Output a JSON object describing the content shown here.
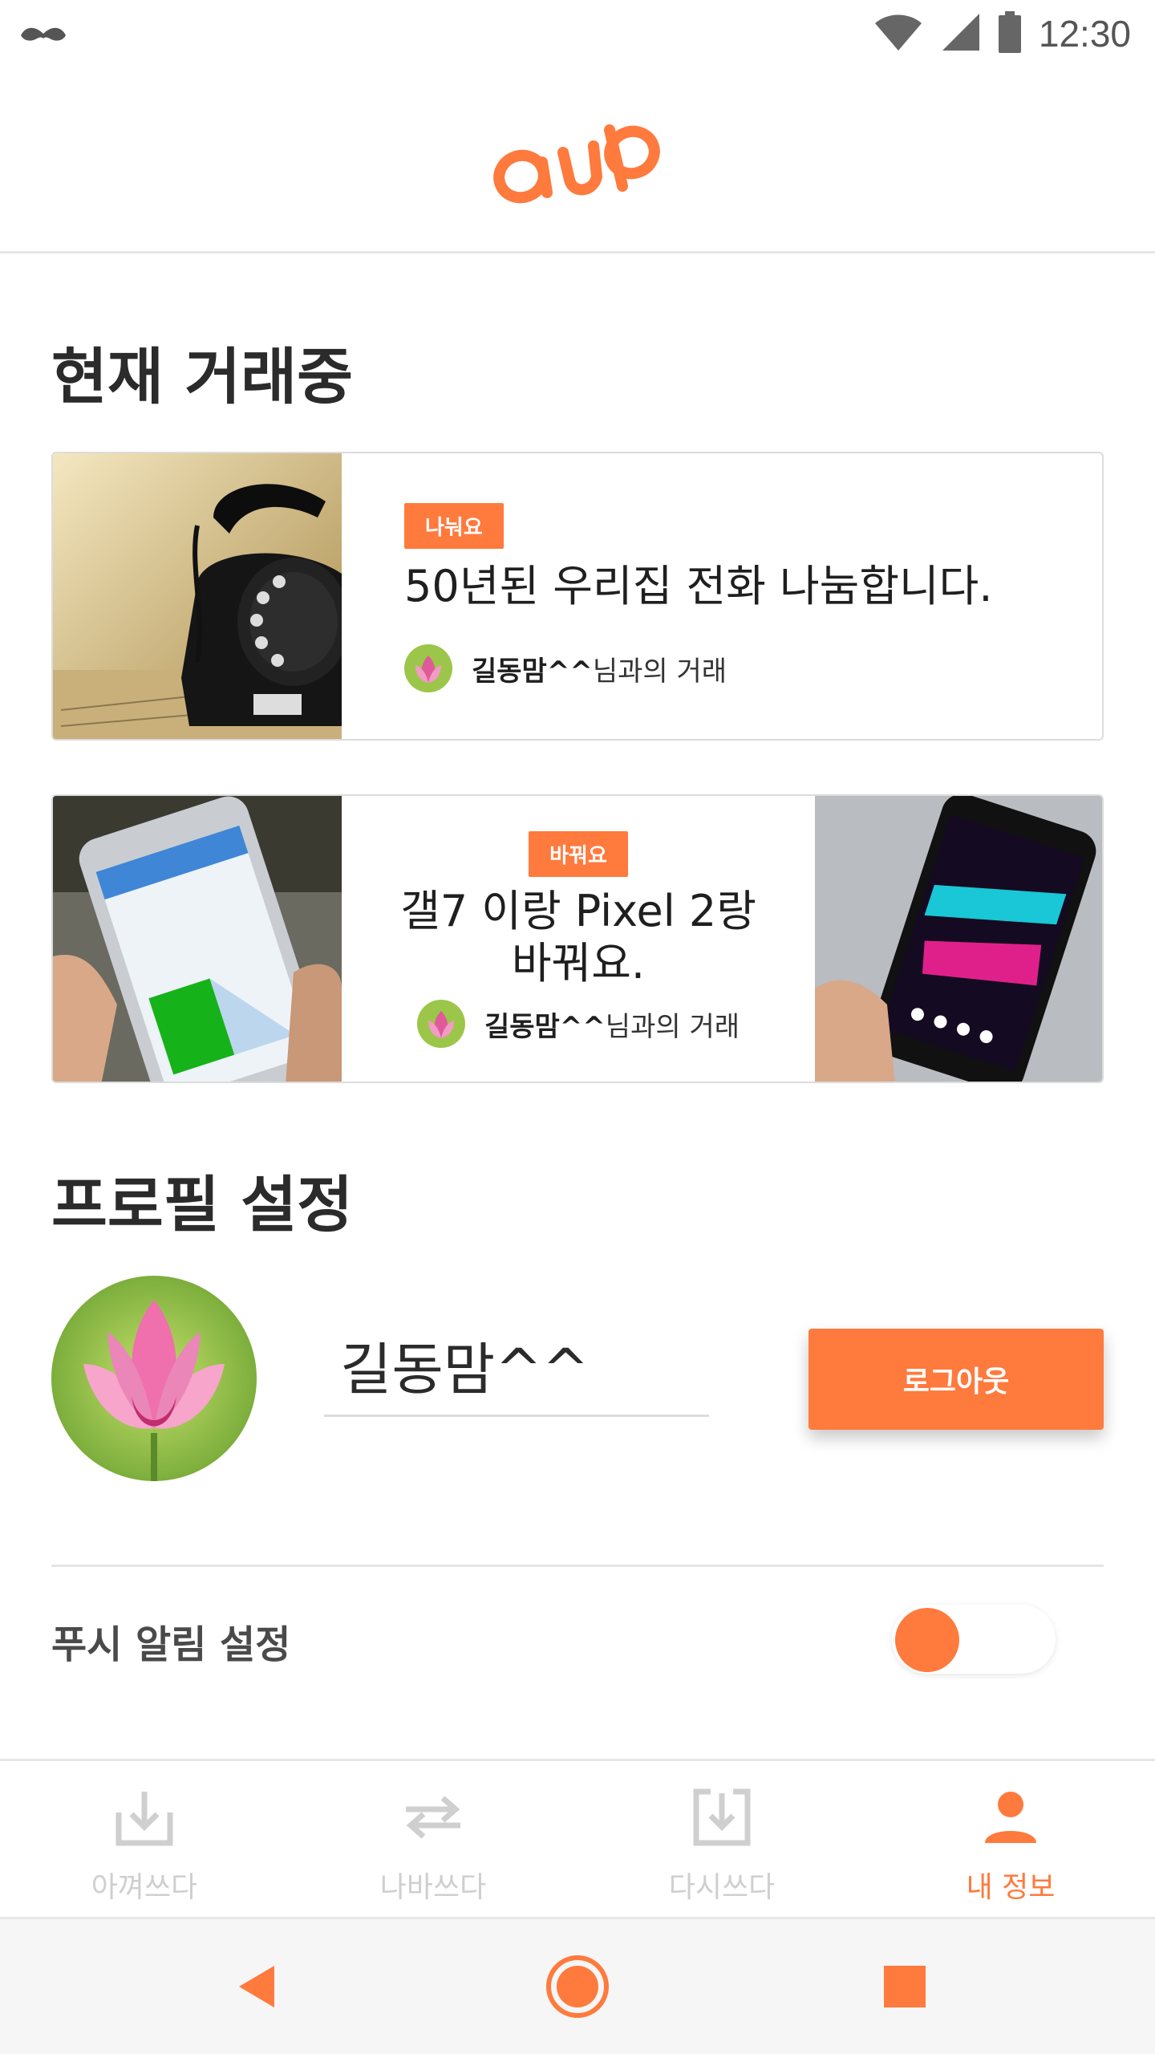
{
  "status_bar": {
    "time": "12:30"
  },
  "colors": {
    "accent": "#ff7a3d",
    "text_dark": "#2b2b2b",
    "tab_inactive": "#cfcfcf"
  },
  "sections": {
    "trading_title": "현재 거래중",
    "profile_title": "프로필 설정"
  },
  "trades": [
    {
      "badge": "나눠요",
      "title": "50년된 우리집 전화 나눔합니다.",
      "partner_name": "길동맘^^",
      "partner_suffix": "님과의 거래"
    },
    {
      "badge": "바꿔요",
      "title_line1": "갤7 이랑 Pixel 2랑",
      "title_line2": "바꿔요.",
      "partner_name": "길동맘^^",
      "partner_suffix": "님과의 거래"
    }
  ],
  "profile": {
    "nickname": "길동맘^^",
    "logout_label": "로그아웃"
  },
  "push": {
    "label": "푸시 알림 설정",
    "enabled": false
  },
  "tabs": [
    {
      "label": "아껴쓰다",
      "icon": "download-box-icon",
      "active": false
    },
    {
      "label": "나바쓰다",
      "icon": "exchange-arrows-icon",
      "active": false
    },
    {
      "label": "다시쓰다",
      "icon": "reuse-box-icon",
      "active": false
    },
    {
      "label": "내 정보",
      "icon": "person-icon",
      "active": true
    }
  ]
}
